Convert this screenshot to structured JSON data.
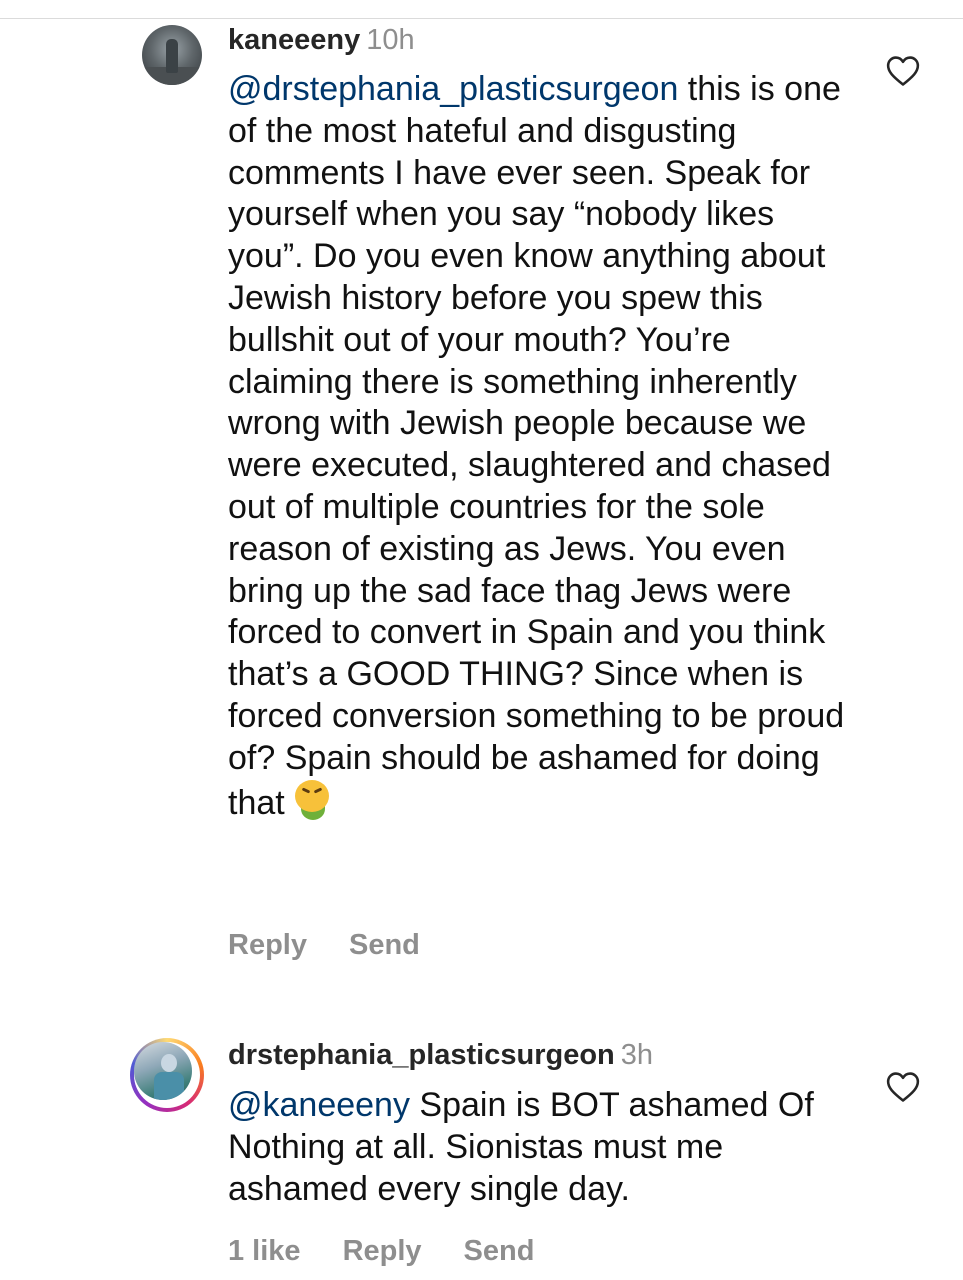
{
  "comments": [
    {
      "username": "kaneeeny",
      "time": "10h",
      "mention": "@drstephania_plasticsurgeon",
      "text": " this is one of the most hateful and disgusting comments I have ever seen. Speak for yourself when you say “nobody likes you”. Do you even know anything about Jewish history before you spew this bullshit out of your mouth? You’re claiming there is something inherently wrong with Jewish people because we were executed, slaughtered and chased out of multiple countries for the sole reason of existing as Jews. You even bring up the sad face thag Jews were forced to convert in Spain and you think that’s a GOOD THING? Since when is forced conversion something to be proud of? Spain should be ashamed for doing that",
      "emoji": "face-vomiting-emoji",
      "reply_label": "Reply",
      "send_label": "Send",
      "like_icon": "heart-outline-icon"
    },
    {
      "username": "drstephania_plasticsurgeon",
      "time": "3h",
      "mention": "@kaneeeny",
      "text": " Spain is BOT ashamed Of Nothing at all. Sionistas must me ashamed every single day.",
      "likes_label": "1 like",
      "reply_label": "Reply",
      "send_label": "Send",
      "like_icon": "heart-outline-icon"
    }
  ],
  "colors": {
    "username": "#262626",
    "mention": "#00376b",
    "secondary": "#8e8e8e",
    "story_ring": "#d62976"
  }
}
